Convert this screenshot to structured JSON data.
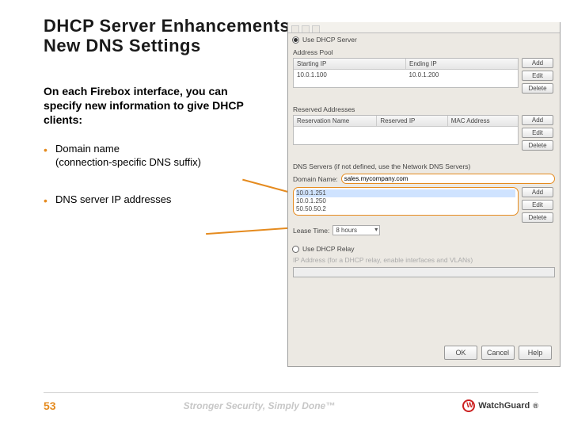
{
  "title": {
    "line1": "DHCP Server Enhancements",
    "line2": "New DNS Settings"
  },
  "intro": "On each Firebox interface, you can specify new information to give DHCP clients:",
  "bullets": [
    {
      "main": "Domain name",
      "sub": "(connection-specific DNS suffix)"
    },
    {
      "main": "DNS server IP addresses",
      "sub": ""
    }
  ],
  "panel": {
    "use_dhcp_server": "Use DHCP Server",
    "address_pool": "Address Pool",
    "cols_pool": [
      "Starting IP",
      "Ending IP"
    ],
    "pool_row": [
      "10.0.1.100",
      "10.0.1.200"
    ],
    "reserved": "Reserved Addresses",
    "cols_res": [
      "Reservation Name",
      "Reserved IP",
      "MAC Address"
    ],
    "dns_section": "DNS Servers (if not defined, use the Network DNS Servers)",
    "domain_label": "Domain Name:",
    "domain_value": "sales.mycompany.com",
    "dns_list": [
      "10.0.1.251",
      "10.0.1.250",
      "50.50.50.2"
    ],
    "lease_label": "Lease Time:",
    "lease_value": "8 hours",
    "use_relay": "Use DHCP Relay",
    "relay_label": "IP Address (for a DHCP relay, enable interfaces and VLANs)",
    "btn_add": "Add",
    "btn_edit": "Edit",
    "btn_delete": "Delete",
    "btn_ok": "OK",
    "btn_cancel": "Cancel",
    "btn_help": "Help"
  },
  "footer": {
    "page": "53",
    "tagline": "Stronger Security, Simply Done™",
    "brand": "WatchGuard",
    "reg": "®"
  }
}
